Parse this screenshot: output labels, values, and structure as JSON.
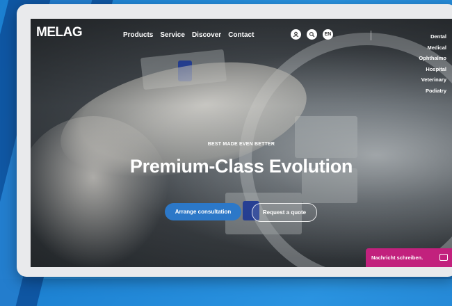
{
  "site": {
    "logo": "MELAG"
  },
  "nav": {
    "items": [
      "Products",
      "Service",
      "Discover",
      "Contact"
    ],
    "icons": [
      "user-icon",
      "search-icon"
    ],
    "language": "EN"
  },
  "sidebar": {
    "items": [
      "Dental",
      "Medical",
      "Ophthalmo",
      "Hospital",
      "Veterinary",
      "Podiatry"
    ]
  },
  "hero": {
    "eyebrow": "BEST MADE EVEN BETTER",
    "headline": "Premium-Class Evolution",
    "primary_button": "Arrange consultation",
    "secondary_button": "Request a quote"
  },
  "chat": {
    "label": "Nachricht schreiben.",
    "icon": "chat-bubble-icon"
  },
  "colors": {
    "accent": "#2c78c8",
    "chat": "#c2217d",
    "background": "#1b7fd0"
  }
}
